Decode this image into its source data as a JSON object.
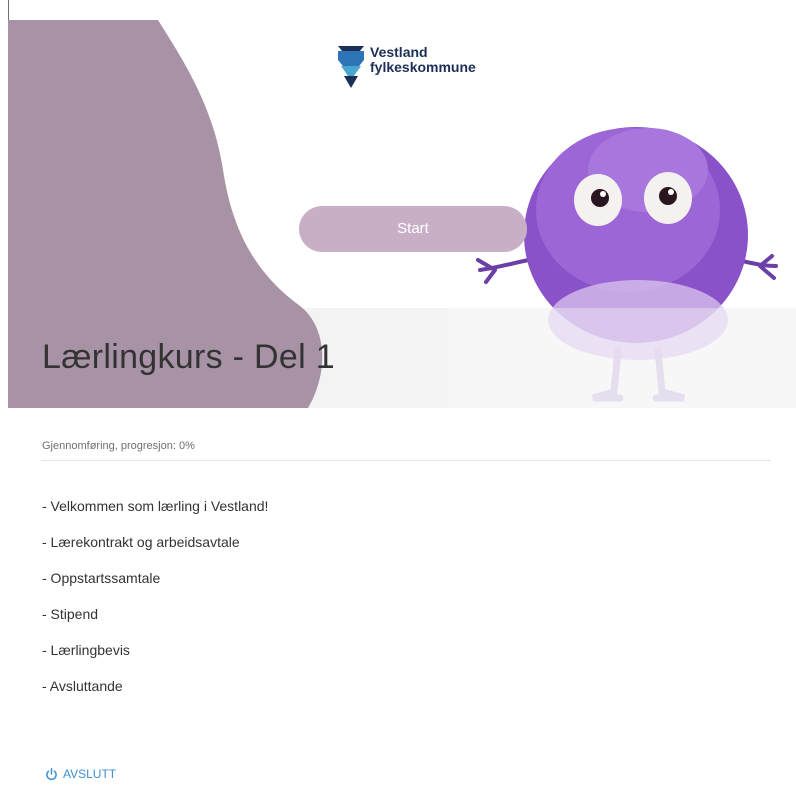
{
  "brand": {
    "line1": "Vestland",
    "line2": "fylkeskommune",
    "icon": "vestland-logo-icon"
  },
  "hero": {
    "start_label": "Start",
    "accent_color": "#a892a5",
    "mascot": "purple-fluffy-monster-illustration"
  },
  "course": {
    "title": "Lærlingkurs - Del 1",
    "progress_text": "Gjennomføring, progresjon: 0%",
    "progress_percent": 0
  },
  "modules": [
    "- Velkommen som lærling i Vestland!",
    "- Lærekontrakt og arbeidsavtale",
    "- Oppstartssamtale",
    "- Stipend",
    "- Lærlingbevis",
    "- Avsluttande"
  ],
  "exit": {
    "label": "AVSLUTT",
    "icon": "power-icon",
    "color": "#3f8fd0"
  }
}
